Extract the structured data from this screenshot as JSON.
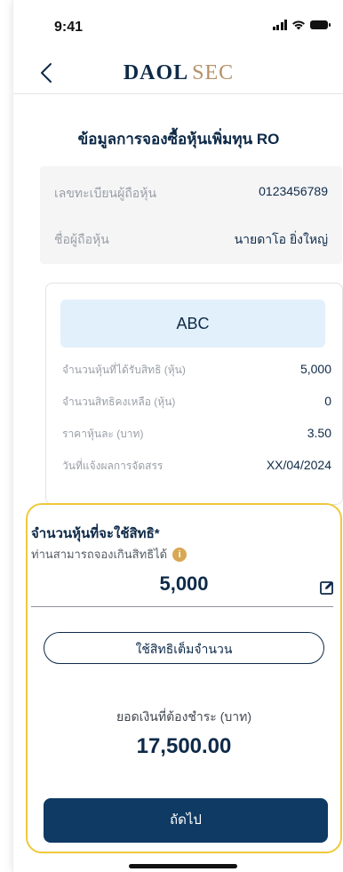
{
  "status_bar": {
    "time": "9:41"
  },
  "header": {
    "back_icon": "chevron-left-icon",
    "logo": {
      "primary": "DAOL",
      "secondary": "SEC"
    }
  },
  "page": {
    "title": "ข้อมูลการจองซื้อหุ้นเพิ่มทุน RO"
  },
  "holder_info": [
    {
      "label": "เลขทะเบียนผู้ถือหุ้น",
      "value": "0123456789"
    },
    {
      "label": "ชื่อผู้ถือหุ้น",
      "value": "นายดาโอ ยิ่งใหญ่"
    }
  ],
  "stock": {
    "symbol": "ABC",
    "rows": [
      {
        "label": "จำนวนหุ้นที่ได้รับสิทธิ (หุ้น)",
        "value": "5,000"
      },
      {
        "label": "จำนวนสิทธิคงเหลือ (หุ้น)",
        "value": "0"
      },
      {
        "label": "ราคาหุ้นละ (บาท)",
        "value": "3.50"
      },
      {
        "label": "วันที่แจ้งผลการจัดสรร",
        "value": "XX/04/2024"
      }
    ]
  },
  "rights": {
    "title": "จำนวนหุ้นที่จะใช้สิทธิ*",
    "hint": "ท่านสามารถจองเกินสิทธิได้",
    "quantity": "5,000",
    "use_full_label": "ใช้สิทธิเต็มจำนวน",
    "payment_label": "ยอดเงินที่ต้องชำระ (บาท)",
    "payment_amount": "17,500.00",
    "next_label": "ถัดไป"
  },
  "colors": {
    "primary": "#0e2a48",
    "button": "#0e3a63",
    "accent_gold": "#b69068",
    "highlight_border": "#f0c93b",
    "banner_bg": "#e2f0fb"
  }
}
